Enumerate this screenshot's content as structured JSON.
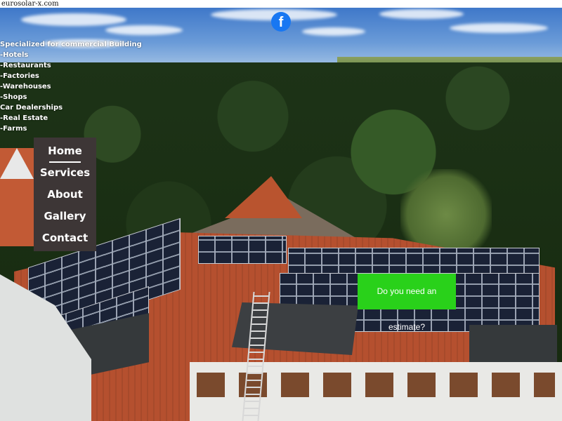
{
  "site": {
    "url_text": "eurosolar-x.com"
  },
  "social": {
    "facebook_glyph": "f",
    "facebook_icon": "facebook-icon",
    "facebook_color": "#1877f2"
  },
  "promo": {
    "headline": "Specialized for commercial Building",
    "items": [
      "-Hotels",
      "-Restaurants",
      "-Factories",
      "-Warehouses",
      "-Shops",
      "Car Dealerships",
      "-Real Estate",
      "-Farms"
    ]
  },
  "nav": {
    "background": "#3d3636",
    "active_index": 0,
    "items": [
      {
        "label": "Home"
      },
      {
        "label": "Services"
      },
      {
        "label": "About"
      },
      {
        "label": "Gallery"
      },
      {
        "label": "Contact"
      }
    ]
  },
  "cta": {
    "label": "Do you need an estimate?",
    "color": "#29d11a"
  }
}
